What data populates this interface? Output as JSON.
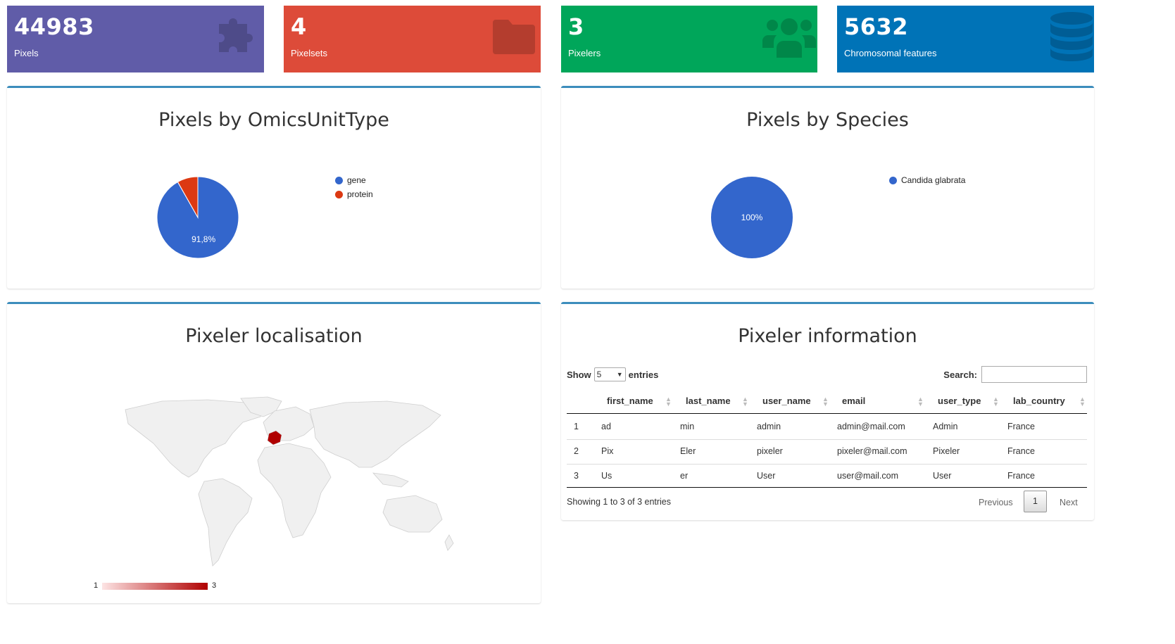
{
  "value_boxes": [
    {
      "value": "44983",
      "caption": "Pixels",
      "color": "#605ca8",
      "icon": "puzzle-icon"
    },
    {
      "value": "4",
      "caption": "Pixelsets",
      "color": "#dd4b39",
      "icon": "folder-icon"
    },
    {
      "value": "3",
      "caption": "Pixelers",
      "color": "#00a65a",
      "icon": "users-icon"
    },
    {
      "value": "5632",
      "caption": "Chromosomal features",
      "color": "#0073b7",
      "icon": "database-icon"
    }
  ],
  "panels": {
    "omics": {
      "title": "Pixels by OmicsUnitType"
    },
    "species": {
      "title": "Pixels by Species"
    },
    "map": {
      "title": "Pixeler localisation",
      "legend_min": "1",
      "legend_max": "3",
      "highlighted_country": "France",
      "highlight_color": "#b00000"
    },
    "info": {
      "title": "Pixeler information"
    }
  },
  "chart_data": [
    {
      "type": "pie",
      "title": "Pixels by OmicsUnitType",
      "labels": [
        "gene",
        "protein"
      ],
      "values": [
        91.8,
        8.2
      ],
      "colors": [
        "#3366cc",
        "#dc3912"
      ],
      "slice_label": "91,8%",
      "legend_position": "right"
    },
    {
      "type": "pie",
      "title": "Pixels by Species",
      "labels": [
        "Candida glabrata"
      ],
      "values": [
        100
      ],
      "colors": [
        "#3366cc"
      ],
      "slice_label": "100%",
      "legend_position": "right"
    }
  ],
  "table": {
    "show_label": "Show",
    "length_value": "5",
    "entries_label": "entries",
    "search_label": "Search:",
    "search_value": "",
    "columns": [
      "first_name",
      "last_name",
      "user_name",
      "email",
      "user_type",
      "lab_country"
    ],
    "rows": [
      [
        "1",
        "ad",
        "min",
        "admin",
        "admin@mail.com",
        "Admin",
        "France"
      ],
      [
        "2",
        "Pix",
        "Eler",
        "pixeler",
        "pixeler@mail.com",
        "Pixeler",
        "France"
      ],
      [
        "3",
        "Us",
        "er",
        "User",
        "user@mail.com",
        "User",
        "France"
      ]
    ],
    "info": "Showing 1 to 3 of 3 entries",
    "prev": "Previous",
    "page": "1",
    "next": "Next"
  }
}
